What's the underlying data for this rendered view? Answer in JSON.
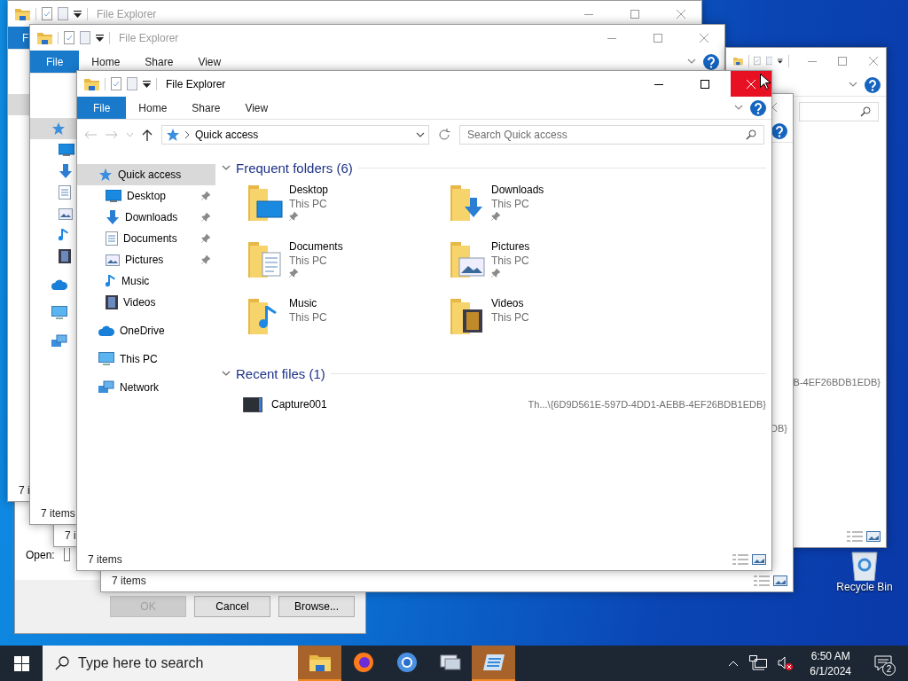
{
  "run_dialog": {
    "open_label": "Open:",
    "buttons": [
      {
        "label": "OK",
        "disabled": true
      },
      {
        "label": "Cancel",
        "disabled": false
      },
      {
        "label": "Browse...",
        "disabled": false
      }
    ]
  },
  "desktop_icons": [
    {
      "label": "Recycle Bin"
    }
  ],
  "back_windows": [
    {
      "title": "File Explorer",
      "tabs": [
        {
          "label": "F",
          "selected": true
        }
      ],
      "status": "7 i"
    },
    {
      "title": "File Explorer",
      "tabs": [
        {
          "label": "File",
          "selected": true
        },
        {
          "label": "Home",
          "selected": false
        },
        {
          "label": "Share",
          "selected": false
        },
        {
          "label": "View",
          "selected": false
        }
      ],
      "status": "7 items"
    },
    {
      "path_fragment": "B-4EF26BDB1EDB}"
    },
    {
      "path_fragment": "DB}",
      "status": "7 items"
    },
    {
      "status": "7 i"
    }
  ],
  "window": {
    "title": "File Explorer",
    "close_hovered": true,
    "tabs": [
      {
        "label": "File",
        "selected": true
      },
      {
        "label": "Home",
        "selected": false
      },
      {
        "label": "Share",
        "selected": false
      },
      {
        "label": "View",
        "selected": false
      }
    ],
    "address": "Quick access",
    "search_placeholder": "Search Quick access",
    "nav": [
      {
        "kind": "star",
        "label": "Quick access",
        "selected": true,
        "children": [
          {
            "kind": "desktop",
            "label": "Desktop",
            "selected": false,
            "pinned": true
          },
          {
            "kind": "downloads",
            "label": "Downloads",
            "selected": false,
            "pinned": true
          },
          {
            "kind": "documents",
            "label": "Documents",
            "selected": false,
            "pinned": true
          },
          {
            "kind": "pictures",
            "label": "Pictures",
            "selected": false,
            "pinned": true
          },
          {
            "kind": "music",
            "label": "Music",
            "selected": false,
            "pinned": false
          },
          {
            "kind": "videos",
            "label": "Videos",
            "selected": false,
            "pinned": false
          }
        ]
      },
      {
        "kind": "onedrive",
        "label": "OneDrive",
        "selected": false
      },
      {
        "kind": "thispc",
        "label": "This PC",
        "selected": false
      },
      {
        "kind": "network",
        "label": "Network",
        "selected": false
      }
    ],
    "frequent_folders": {
      "heading": "Frequent folders (6)",
      "expanded": true,
      "items": [
        {
          "kind": "desktop",
          "name": "Desktop",
          "location": "This PC",
          "pinned": true
        },
        {
          "kind": "downloads",
          "name": "Downloads",
          "location": "This PC",
          "pinned": true
        },
        {
          "kind": "documents",
          "name": "Documents",
          "location": "This PC",
          "pinned": true
        },
        {
          "kind": "pictures",
          "name": "Pictures",
          "location": "This PC",
          "pinned": true
        },
        {
          "kind": "music",
          "name": "Music",
          "location": "This PC",
          "pinned": false
        },
        {
          "kind": "videos",
          "name": "Videos",
          "location": "This PC",
          "pinned": false
        }
      ]
    },
    "recent_files": {
      "heading": "Recent files (1)",
      "expanded": true,
      "items": [
        {
          "name": "Capture001",
          "path": "Th...\\{6D9D561E-597D-4DD1-AEBB-4EF26BDB1EDB}"
        }
      ]
    },
    "status": "7 items"
  },
  "taskbar": {
    "search_placeholder": "Type here to search",
    "apps": [
      {
        "kind": "explorer",
        "selected": true
      },
      {
        "kind": "firefox",
        "selected": false
      },
      {
        "kind": "chrome",
        "selected": false
      },
      {
        "kind": "connect",
        "selected": false
      },
      {
        "kind": "screen",
        "selected": true
      }
    ],
    "time": "6:50 AM",
    "date": "6/1/2024",
    "notifications": "2"
  }
}
